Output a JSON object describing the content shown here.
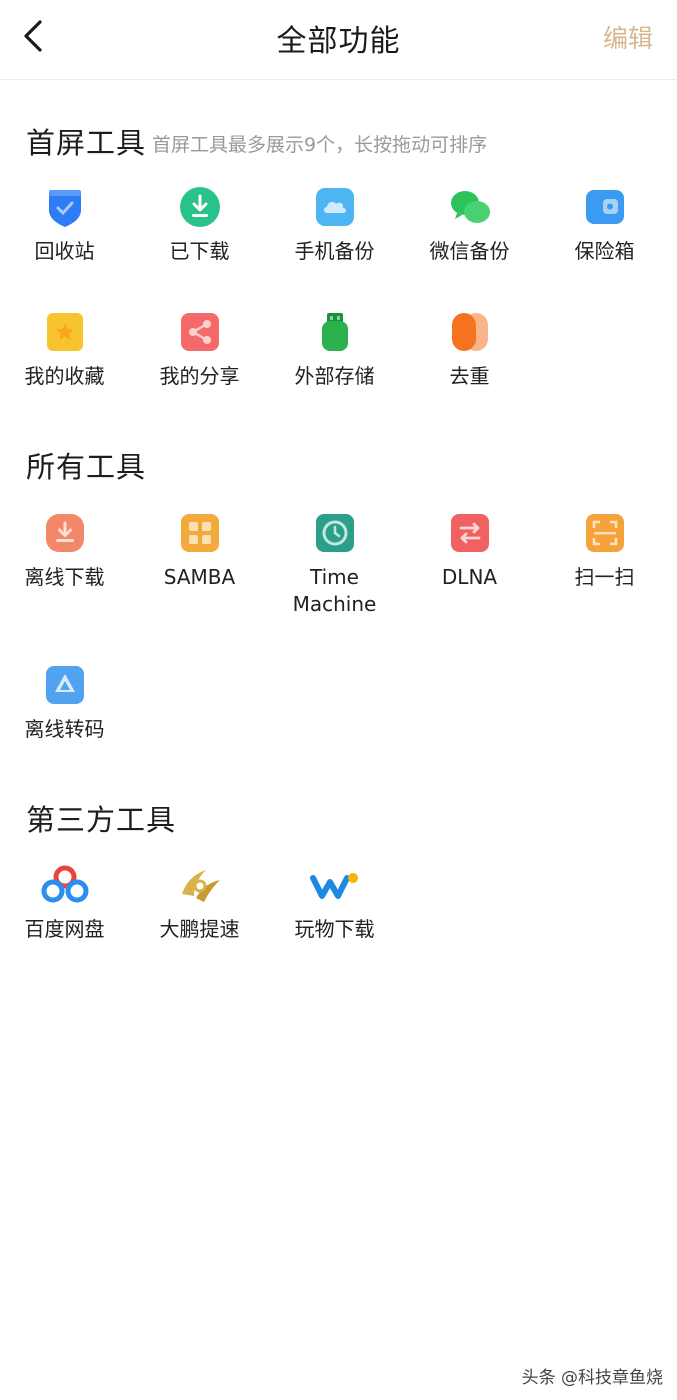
{
  "header": {
    "title": "全部功能",
    "edit_label": "编辑",
    "back_icon": "chevron-left-icon"
  },
  "home_tools": {
    "title": "首屏工具",
    "hint": "首屏工具最多展示9个，长按拖动可排序",
    "items": [
      {
        "label": "回收站",
        "icon": "recycle-bin-icon",
        "color": "#2f7df6"
      },
      {
        "label": "已下载",
        "icon": "downloaded-icon",
        "color": "#29c28a"
      },
      {
        "label": "手机备份",
        "icon": "phone-backup-icon",
        "color": "#4db6f2"
      },
      {
        "label": "微信备份",
        "icon": "wechat-backup-icon",
        "color": "#2dc35a"
      },
      {
        "label": "保险箱",
        "icon": "safe-box-icon",
        "color": "#3b9af2"
      },
      {
        "label": "我的收藏",
        "icon": "favorites-icon",
        "color": "#f8c42d"
      },
      {
        "label": "我的分享",
        "icon": "share-icon",
        "color": "#f46a6a"
      },
      {
        "label": "外部存储",
        "icon": "usb-storage-icon",
        "color": "#2ab24f"
      },
      {
        "label": "去重",
        "icon": "dedupe-icon",
        "color": "#f58a3c"
      }
    ]
  },
  "all_tools": {
    "title": "所有工具",
    "items": [
      {
        "label": "离线下载",
        "icon": "offline-download-icon",
        "color": "#f2876a"
      },
      {
        "label": "SAMBA",
        "icon": "samba-icon",
        "color": "#f4a93b"
      },
      {
        "label": "Time Machine",
        "icon": "time-machine-icon",
        "color": "#2b9f8a"
      },
      {
        "label": "DLNA",
        "icon": "dlna-icon",
        "color": "#f06262"
      },
      {
        "label": "扫一扫",
        "icon": "scan-icon",
        "color": "#f5a23a"
      },
      {
        "label": "离线转码",
        "icon": "offline-transcode-icon",
        "color": "#4fa3f0"
      }
    ]
  },
  "third_party": {
    "title": "第三方工具",
    "items": [
      {
        "label": "百度网盘",
        "icon": "baidu-netdisk-icon"
      },
      {
        "label": "大鹏提速",
        "icon": "dapeng-speedup-icon"
      },
      {
        "label": "玩物下载",
        "icon": "wanwu-download-icon"
      }
    ]
  },
  "watermark": "头条 @科技章鱼烧"
}
